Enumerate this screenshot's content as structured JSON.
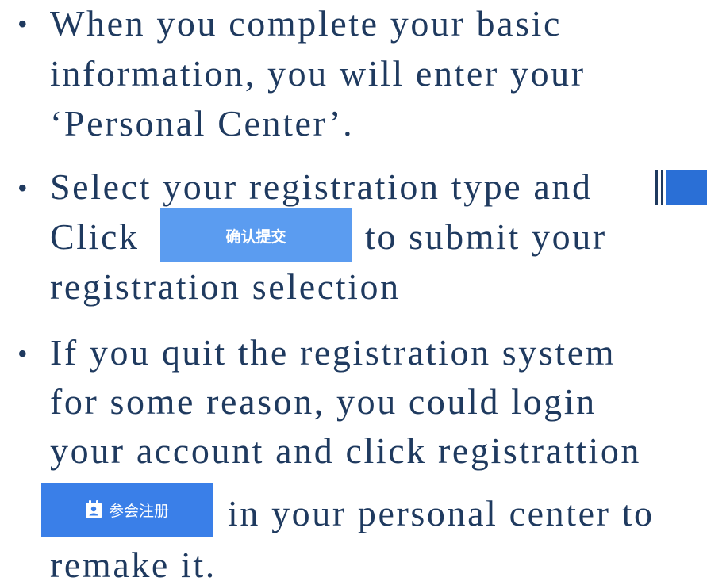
{
  "bullets": [
    {
      "marker": "•",
      "lines": [
        "When you complete your basic",
        "information, you will enter your",
        "‘Personal Center’."
      ]
    },
    {
      "marker": "•",
      "line1": "Select your registration type and",
      "line2_before": "Click",
      "button_label": "确认提交",
      "line2_after": "to submit your",
      "line3": "registration selection"
    },
    {
      "marker": "•",
      "lines": [
        "If you quit the registration system",
        "for some reason, you could login",
        "your account and click registrattion"
      ],
      "button_label": "参会注册",
      "button_icon": "badge-icon",
      "line4_after": "in your personal center to",
      "line5": "remake it."
    }
  ],
  "colors": {
    "text": "#1f3a5f",
    "confirm_button": "#5b9cf0",
    "register_button": "#3a7fe8",
    "edge_accent": "#2a6fd6"
  }
}
